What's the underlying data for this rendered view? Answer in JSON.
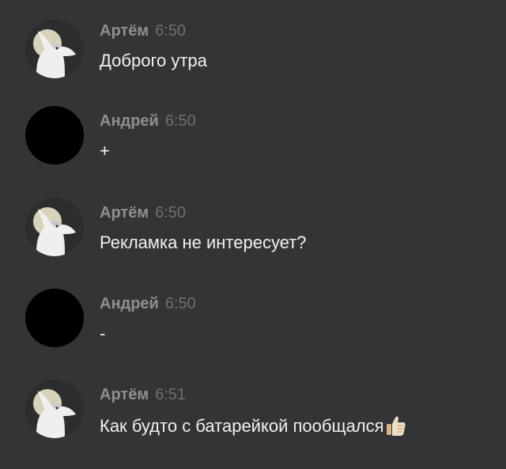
{
  "messages": [
    {
      "author": "Артём",
      "time": "6:50",
      "text": "Доброго утра",
      "avatar": "wolf-avatar"
    },
    {
      "author": "Андрей",
      "time": "6:50",
      "text": "+",
      "avatar": "dark-avatar"
    },
    {
      "author": "Артём",
      "time": "6:50",
      "text": "Рекламка не интересует?",
      "avatar": "wolf-avatar"
    },
    {
      "author": "Андрей",
      "time": "6:50",
      "text": "-",
      "avatar": "dark-avatar"
    },
    {
      "author": "Артём",
      "time": "6:51",
      "text": "Как будто с батарейкой пообщался",
      "avatar": "wolf-avatar",
      "emoji": "thumbs-up-icon"
    }
  ],
  "colors": {
    "background": "#333436",
    "author": "#8f8f8f",
    "time": "#6f6f6f",
    "text": "#f1f1f1"
  }
}
